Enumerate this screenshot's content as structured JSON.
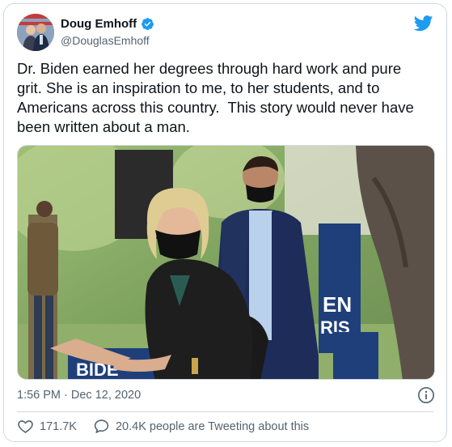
{
  "author": {
    "name": "Doug Emhoff",
    "handle": "@DouglasEmhoff"
  },
  "tweet": {
    "text": "Dr. Biden earned her degrees through hard work and pure\ngrit. She is an inspiration to me, to her students, and to\nAmericans across this country.  This story would never have\nbeen written about a man."
  },
  "meta": {
    "timestamp": "1:56 PM · Dec 12, 2020"
  },
  "actions": {
    "likes": "171.7K",
    "replies": "20.4K people are Tweeting about this"
  },
  "photo": {
    "sign_text_1": "BIDE",
    "sign_text_2": "EN",
    "sign_text_3": "RIS"
  },
  "colors": {
    "brand": "#1d9bf0",
    "secondary_text": "#536471",
    "border": "#cfd9de"
  },
  "icons": [
    "verified-badge-icon",
    "twitter-bird-icon",
    "info-icon",
    "heart-icon",
    "speech-bubble-icon"
  ]
}
